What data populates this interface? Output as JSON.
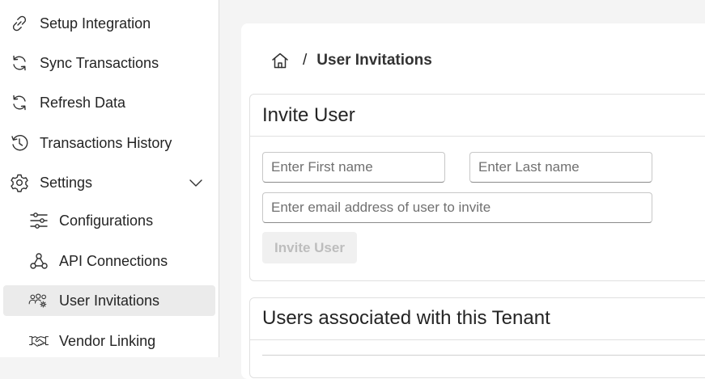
{
  "sidebar": {
    "items": [
      {
        "label": "Setup Integration",
        "icon": "link-icon"
      },
      {
        "label": "Sync Transactions",
        "icon": "sync-icon"
      },
      {
        "label": "Refresh Data",
        "icon": "refresh-icon"
      },
      {
        "label": "Transactions History",
        "icon": "history-icon"
      },
      {
        "label": "Settings",
        "icon": "gear-icon",
        "expanded": true
      },
      {
        "label": "Configurations",
        "icon": "sliders-icon"
      },
      {
        "label": "API Connections",
        "icon": "webhook-icon"
      },
      {
        "label": "User Invitations",
        "icon": "people-settings-icon",
        "active": true
      },
      {
        "label": "Vendor Linking",
        "icon": "handshake-icon"
      }
    ]
  },
  "breadcrumb": {
    "separator": "/",
    "current": "User Invitations"
  },
  "invite_panel": {
    "title": "Invite User",
    "first_name_placeholder": "Enter First name",
    "last_name_placeholder": "Enter Last name",
    "email_placeholder": "Enter email address of user to invite",
    "button_label": "Invite User",
    "button_disabled": true
  },
  "users_panel": {
    "title": "Users associated with this Tenant"
  },
  "colors": {
    "active_item_bg": "#ebebeb",
    "page_bg": "#f4f4f4",
    "disabled_text": "#bdbdbd"
  }
}
